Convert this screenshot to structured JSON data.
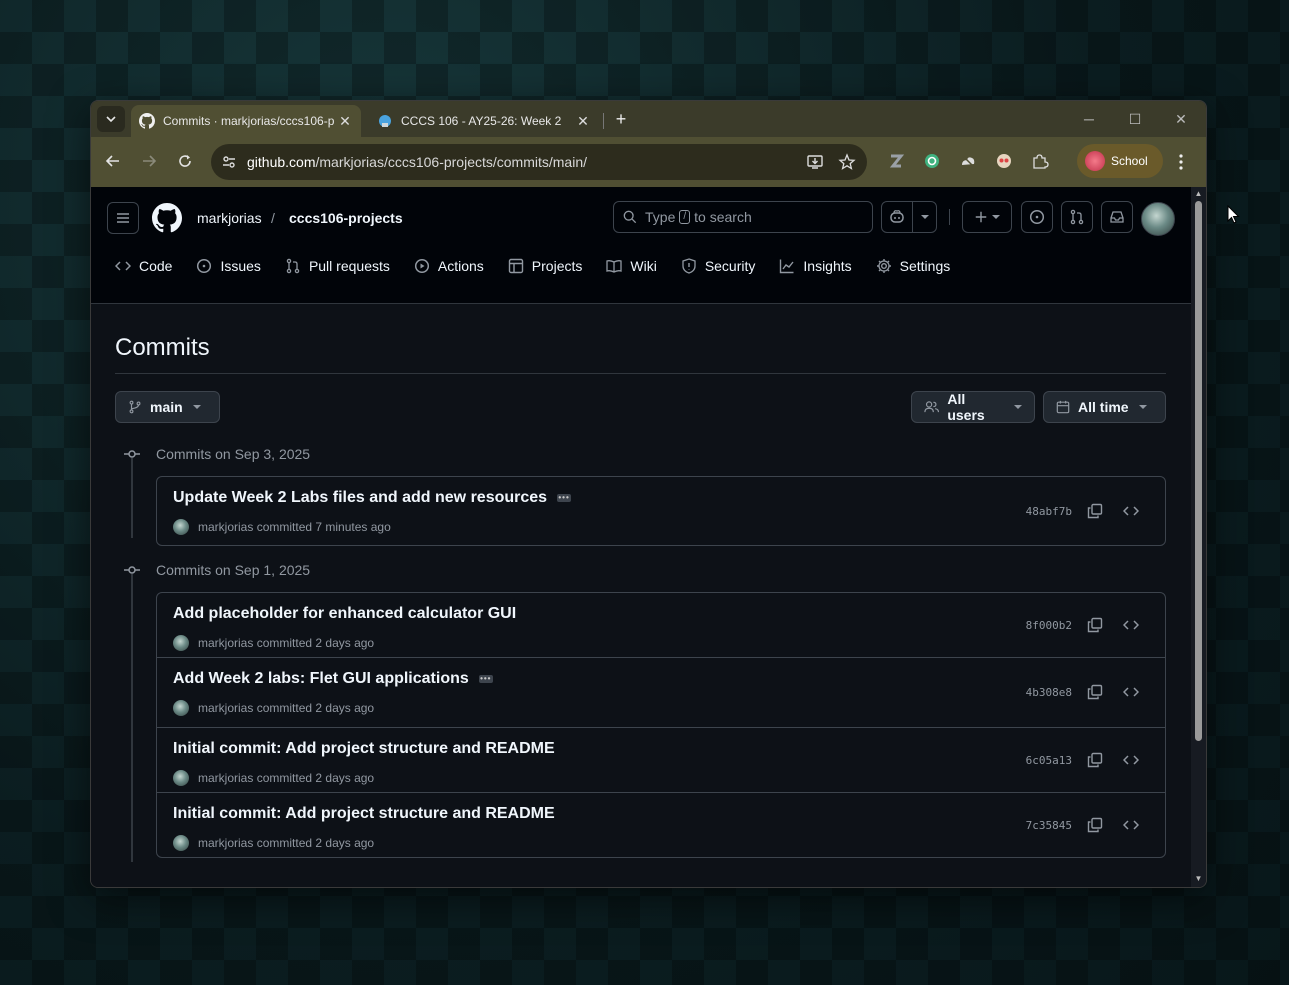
{
  "browser": {
    "tabs": [
      {
        "title": "Commits · markjorias/cccs106-p",
        "favicon": "github-icon",
        "active": true
      },
      {
        "title": "CCCS 106 - AY25-26: Week 2",
        "favicon": "course-icon",
        "active": false
      }
    ],
    "url_host": "github.com",
    "url_path": "/markjorias/cccs106-projects/commits/main/",
    "profile_label": "School"
  },
  "header": {
    "owner": "markjorias",
    "separator": "/",
    "repo": "cccs106-projects",
    "search_prefix": "Type",
    "search_key": "/",
    "search_suffix": "to search"
  },
  "repo_nav": {
    "items": [
      {
        "label": "Code",
        "icon": "code-icon"
      },
      {
        "label": "Issues",
        "icon": "issue-icon"
      },
      {
        "label": "Pull requests",
        "icon": "pull-request-icon"
      },
      {
        "label": "Actions",
        "icon": "play-icon"
      },
      {
        "label": "Projects",
        "icon": "table-icon"
      },
      {
        "label": "Wiki",
        "icon": "book-icon"
      },
      {
        "label": "Security",
        "icon": "shield-icon"
      },
      {
        "label": "Insights",
        "icon": "graph-icon"
      },
      {
        "label": "Settings",
        "icon": "gear-icon"
      }
    ]
  },
  "page": {
    "title": "Commits",
    "branch": "main",
    "users_filter": "All users",
    "time_filter": "All time"
  },
  "groups": [
    {
      "heading": "Commits on Sep 3, 2025",
      "commits": [
        {
          "message": "Update Week 2 Labs files and add new resources",
          "has_more": true,
          "author": "markjorias",
          "verb": "committed",
          "when": "7 minutes ago",
          "sha": "48abf7b"
        }
      ]
    },
    {
      "heading": "Commits on Sep 1, 2025",
      "commits": [
        {
          "message": "Add placeholder for enhanced calculator GUI",
          "has_more": false,
          "author": "markjorias",
          "verb": "committed",
          "when": "2 days ago",
          "sha": "8f000b2"
        },
        {
          "message": "Add Week 2 labs: Flet GUI applications",
          "has_more": true,
          "author": "markjorias",
          "verb": "committed",
          "when": "2 days ago",
          "sha": "4b308e8"
        },
        {
          "message": "Initial commit: Add project structure and README",
          "has_more": false,
          "author": "markjorias",
          "verb": "committed",
          "when": "2 days ago",
          "sha": "6c05a13"
        },
        {
          "message": "Initial commit: Add project structure and README",
          "has_more": false,
          "author": "markjorias",
          "verb": "committed",
          "when": "2 days ago",
          "sha": "7c35845"
        }
      ]
    }
  ],
  "colors": {
    "page_bg": "#0d1117",
    "header_bg": "#010409",
    "border": "#3d444d",
    "text": "#f0f6fc",
    "muted": "#9198a1",
    "browser_frame": "#504f33"
  }
}
